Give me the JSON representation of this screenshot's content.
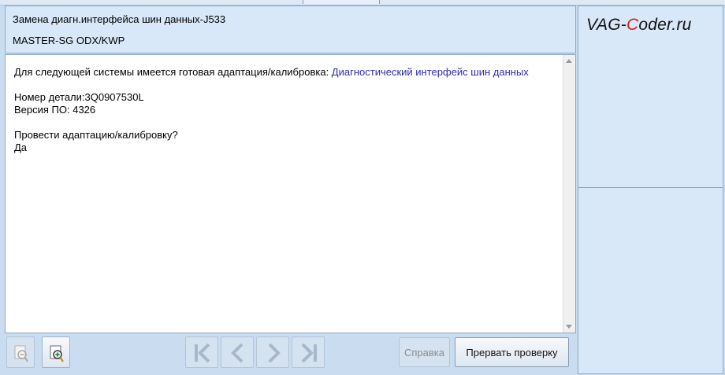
{
  "header": {
    "title": "Замена диагн.интерфейса шин данных-J533",
    "subtitle": "MASTER-SG ODX/KWP"
  },
  "content": {
    "intro_prefix": "Для следующей системы имеется готовая адаптация/калибровка: ",
    "intro_system": "Диагностический интерфейс шин данных",
    "part_number": "Номер детали:3Q0907530L",
    "software_version": "Версия ПО: 4326",
    "question": "Провести адаптацию/калибровку?",
    "answer": "Да"
  },
  "watermark": {
    "prefix": "VAG-",
    "highlight": "C",
    "suffix": "oder.ru"
  },
  "toolbar": {
    "zoom_out_icon": "zoom-out-icon",
    "zoom_in_icon": "zoom-in-icon",
    "nav_icons": [
      "first-icon",
      "prev-icon",
      "next-icon",
      "last-icon"
    ],
    "help_label": "Справка",
    "abort_label": "Прервать проверку"
  },
  "colors": {
    "frame": "#c9dcf0",
    "panel": "#d8e8f8",
    "link": "#2a2ab8",
    "logo_accent": "#d21f1f"
  }
}
